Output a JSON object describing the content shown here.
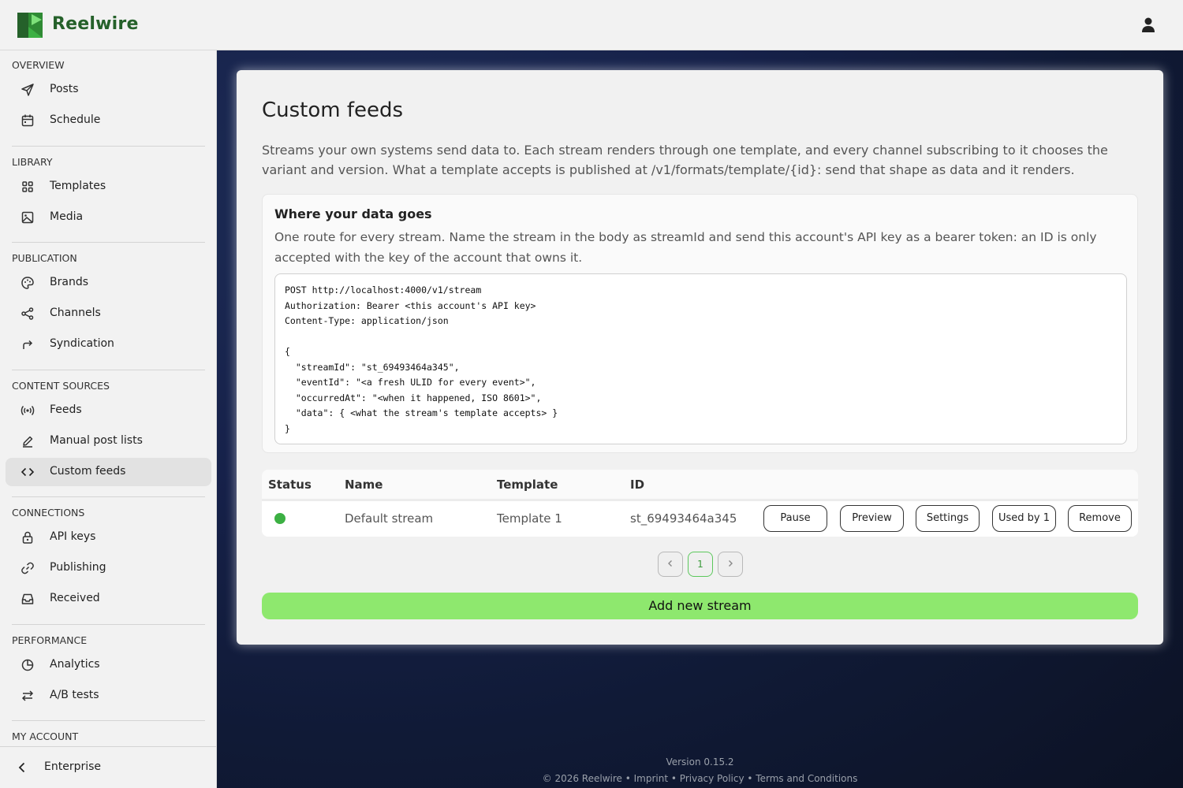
{
  "app": {
    "name": "Reelwire"
  },
  "sidebar": {
    "sections": [
      {
        "title": "OVERVIEW",
        "items": [
          {
            "label": "Posts",
            "icon": "send-icon"
          },
          {
            "label": "Schedule",
            "icon": "calendar-icon"
          }
        ]
      },
      {
        "title": "LIBRARY",
        "items": [
          {
            "label": "Templates",
            "icon": "grid-icon"
          },
          {
            "label": "Media",
            "icon": "image-icon"
          }
        ]
      },
      {
        "title": "PUBLICATION",
        "items": [
          {
            "label": "Brands",
            "icon": "palette-icon"
          },
          {
            "label": "Channels",
            "icon": "share-icon"
          },
          {
            "label": "Syndication",
            "icon": "forward-arrow-icon"
          }
        ]
      },
      {
        "title": "CONTENT SOURCES",
        "items": [
          {
            "label": "Feeds",
            "icon": "broadcast-icon"
          },
          {
            "label": "Manual post lists",
            "icon": "pencil-icon"
          },
          {
            "label": "Custom feeds",
            "icon": "code-icon",
            "active": true
          }
        ]
      },
      {
        "title": "CONNECTIONS",
        "items": [
          {
            "label": "API keys",
            "icon": "lock-icon"
          },
          {
            "label": "Publishing",
            "icon": "link-icon"
          },
          {
            "label": "Received",
            "icon": "inbox-icon"
          }
        ]
      },
      {
        "title": "PERFORMANCE",
        "items": [
          {
            "label": "Analytics",
            "icon": "pie-chart-icon"
          },
          {
            "label": "A/B tests",
            "icon": "swap-arrows-icon"
          }
        ]
      },
      {
        "title": "MY ACCOUNT",
        "items": []
      }
    ],
    "footer_label": "Enterprise"
  },
  "page": {
    "title": "Custom feeds",
    "intro": "Streams your own systems send data to. Each stream renders through one template, and every channel subscribing to it chooses the variant and version. What a template accepts is published at /v1/formats/template/{id}: send that shape as data and it renders."
  },
  "info": {
    "title": "Where your data goes",
    "text": "One route for every stream. Name the stream in the body as streamId and send this account's API key as a bearer token: an ID is only accepted with the key of the account that owns it.",
    "code_lines": [
      "POST http://localhost:4000/v1/stream",
      "Authorization: Bearer <this account's API key>",
      "Content-Type: application/json",
      "",
      "{",
      "  \"streamId\": \"st_69493464a345\",",
      "  \"eventId\": \"<a fresh ULID for every event>\",",
      "  \"occurredAt\": \"<when it happened, ISO 8601>\",",
      "  \"data\": { <what the stream's template accepts> }",
      "}"
    ]
  },
  "table": {
    "headers": {
      "status": "Status",
      "name": "Name",
      "template": "Template",
      "id": "ID"
    },
    "rows": [
      {
        "status_color": "#3cb043",
        "name": "Default stream",
        "template": "Template 1",
        "id": "st_69493464a345",
        "actions": {
          "pause": "Pause",
          "preview": "Preview",
          "settings": "Settings",
          "used_by": "Used by 1",
          "remove": "Remove"
        }
      }
    ]
  },
  "pagination": {
    "current": "1",
    "prev_icon": "chevron-left-icon",
    "next_icon": "chevron-right-icon"
  },
  "add_button": "Add new stream",
  "footer": {
    "version": "Version 0.15.2",
    "copyright": "© 2026 Reelwire",
    "sep": " • ",
    "imprint": "Imprint",
    "privacy": "Privacy Policy",
    "terms": "Terms and Conditions"
  },
  "colors": {
    "brand": "#25612a",
    "accent_green": "#8ee86e",
    "status_active": "#3cb043"
  }
}
